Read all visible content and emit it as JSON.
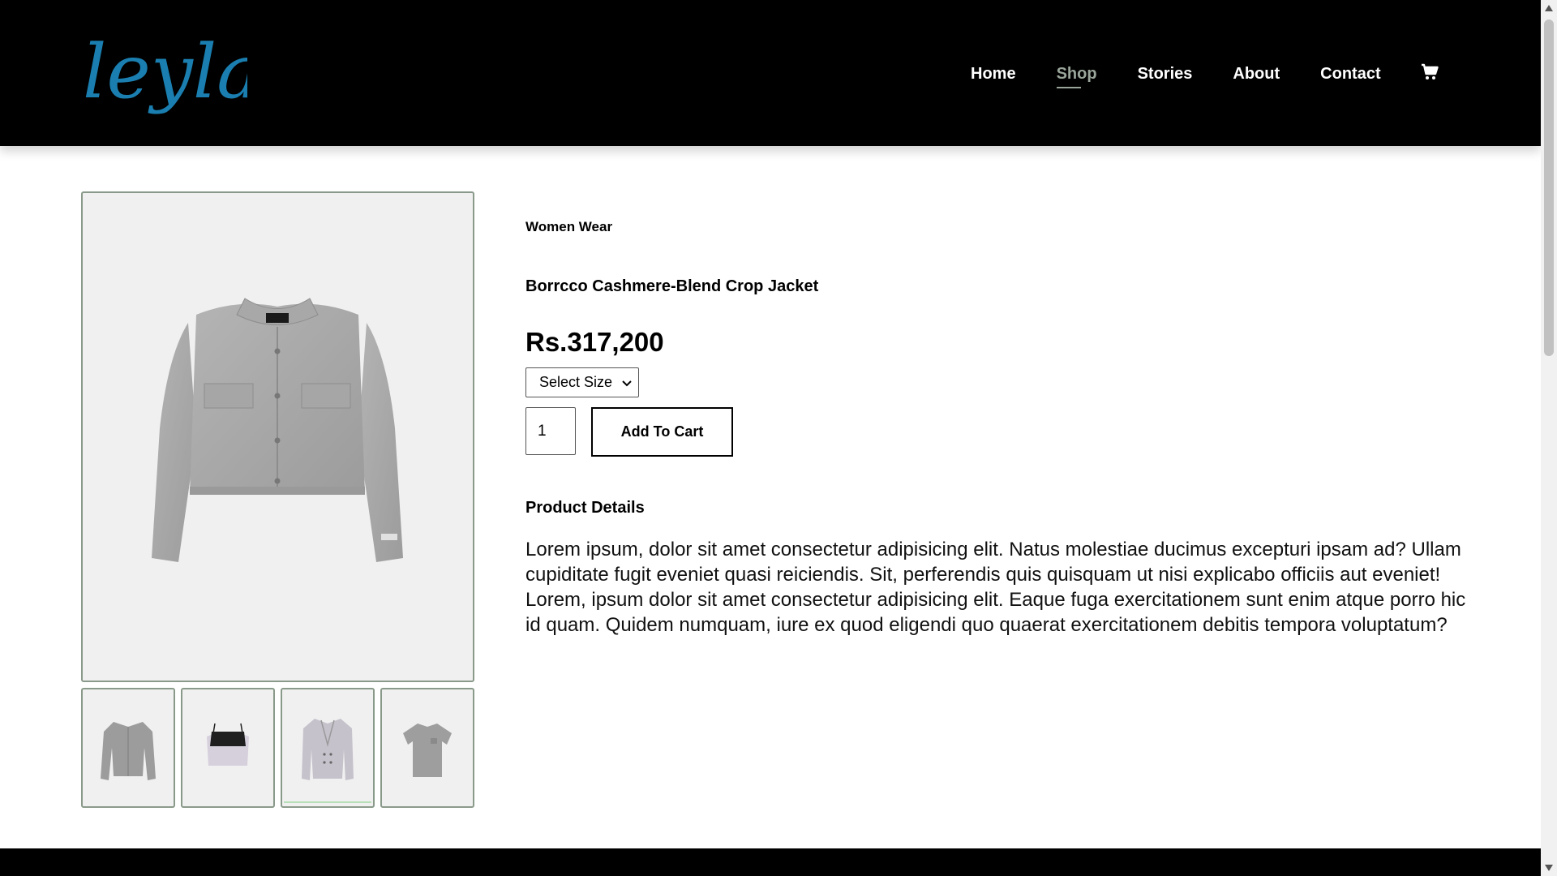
{
  "brand": {
    "logo_text": "leyla",
    "logo_color": "#1a7fb0"
  },
  "nav": {
    "items": [
      {
        "label": "Home",
        "active": false
      },
      {
        "label": "Shop",
        "active": true
      },
      {
        "label": "Stories",
        "active": false
      },
      {
        "label": "About",
        "active": false
      },
      {
        "label": "Contact",
        "active": false
      }
    ],
    "cart_icon": "shopping-cart-icon"
  },
  "gallery": {
    "main_image": "cropped-cashmere-jacket-image",
    "thumbnails": [
      {
        "name": "cardigan-thumbnail"
      },
      {
        "name": "crop-top-thumbnail"
      },
      {
        "name": "blazer-thumbnail"
      },
      {
        "name": "tshirt-thumbnail"
      }
    ]
  },
  "product": {
    "category": "Women Wear",
    "title": "Borrcco Cashmere-Blend Crop Jacket",
    "price": "Rs.317,200",
    "size_select": {
      "selected": "Select Size"
    },
    "quantity": "1",
    "add_to_cart_label": "Add To Cart",
    "details_heading": "Product Details",
    "details_text": "Lorem ipsum, dolor sit amet consectetur adipisicing elit. Natus molestiae ducimus excepturi ipsam ad? Ullam cupiditate fugit eveniet quasi reiciendis. Sit, perferendis quis quisquam ut nisi explicabo officiis aut eveniet! Lorem, ipsum dolor sit amet consectetur adipisicing elit. Eaque fuga exercitationem sunt enim atque porro hic id quam. Quidem numquam, iure ex quod eligendi quo quaerat exercitationem debitis tempora voluptatum?"
  },
  "colors": {
    "header_bg": "#000000",
    "nav_active": "#9aa59a",
    "image_bg": "#f0f0f0",
    "border": "#8a9a8a"
  }
}
